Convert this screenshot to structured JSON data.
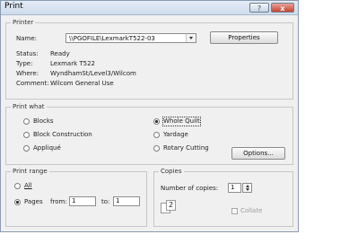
{
  "window": {
    "title": "Print",
    "help_icon": "?",
    "close_icon": "x"
  },
  "printer": {
    "group_label": "Printer",
    "name_label": "Name:",
    "name_value": "\\\\PGOFILE\\LexmarkT522-03",
    "properties_label": "Properties",
    "status_label": "Status:",
    "status_value": "Ready",
    "type_label": "Type:",
    "type_value": "Lexmark T522",
    "where_label": "Where:",
    "where_value": "WyndhamSt/Level3/Wilcom",
    "comment_label": "Comment:",
    "comment_value": "Wilcom General Use"
  },
  "print_what": {
    "group_label": "Print what",
    "options": [
      {
        "label": "Blocks",
        "selected": false
      },
      {
        "label": "Block Construction",
        "selected": false
      },
      {
        "label": "Appliqué",
        "selected": false
      },
      {
        "label": "Whole Quilt",
        "selected": true
      },
      {
        "label": "Yardage",
        "selected": false
      },
      {
        "label": "Rotary Cutting",
        "selected": false
      }
    ],
    "options_button": "Options..."
  },
  "print_range": {
    "group_label": "Print range",
    "all_label": "All",
    "pages_label": "Pages",
    "from_label": "from:",
    "from_value": "1",
    "to_label": "to:",
    "to_value": "1",
    "selected": "Pages"
  },
  "copies": {
    "group_label": "Copies",
    "number_label": "Number of copies:",
    "number_value": "1",
    "collate_label": "Collate",
    "collate_checked": false,
    "collate_icon_text": "2"
  }
}
